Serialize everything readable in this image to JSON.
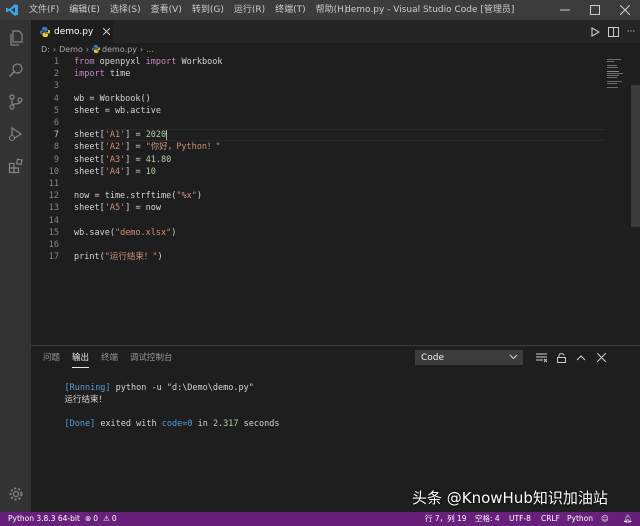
{
  "titlebar": {
    "menu": [
      "文件(F)",
      "编辑(E)",
      "选择(S)",
      "查看(V)",
      "转到(G)",
      "运行(R)",
      "终端(T)",
      "帮助(H)"
    ],
    "title": "demo.py - Visual Studio Code [管理员]"
  },
  "tab": {
    "label": "demo.py"
  },
  "breadcrumb": {
    "drive": "D:",
    "folder": "Demo",
    "file": "demo.py",
    "more": "..."
  },
  "editor": {
    "lines": [
      {
        "n": "1",
        "parts": [
          [
            "kw",
            "from"
          ],
          [
            "plain",
            " openpyxl "
          ],
          [
            "kw",
            "import"
          ],
          [
            "plain",
            " Workbook"
          ]
        ]
      },
      {
        "n": "2",
        "parts": [
          [
            "kw",
            "import"
          ],
          [
            "plain",
            " time"
          ]
        ]
      },
      {
        "n": "3",
        "parts": []
      },
      {
        "n": "4",
        "parts": [
          [
            "plain",
            "wb = Workbook()"
          ]
        ]
      },
      {
        "n": "5",
        "parts": [
          [
            "plain",
            "sheet = wb.active"
          ]
        ]
      },
      {
        "n": "6",
        "parts": []
      },
      {
        "n": "7",
        "parts": [
          [
            "plain",
            "sheet["
          ],
          [
            "str",
            "'A1'"
          ],
          [
            "plain",
            "] = "
          ],
          [
            "num",
            "2020"
          ]
        ]
      },
      {
        "n": "8",
        "parts": [
          [
            "plain",
            "sheet["
          ],
          [
            "str",
            "'A2'"
          ],
          [
            "plain",
            "] = "
          ],
          [
            "str",
            "\"你好，Python！\""
          ]
        ]
      },
      {
        "n": "9",
        "parts": [
          [
            "plain",
            "sheet["
          ],
          [
            "str",
            "'A3'"
          ],
          [
            "plain",
            "] = "
          ],
          [
            "num",
            "41.80"
          ]
        ]
      },
      {
        "n": "10",
        "parts": [
          [
            "plain",
            "sheet["
          ],
          [
            "str",
            "'A4'"
          ],
          [
            "plain",
            "] = "
          ],
          [
            "num",
            "10"
          ]
        ]
      },
      {
        "n": "11",
        "parts": []
      },
      {
        "n": "12",
        "parts": [
          [
            "plain",
            "now = time.strftime("
          ],
          [
            "str",
            "\"%x\""
          ],
          [
            "plain",
            ")"
          ]
        ]
      },
      {
        "n": "13",
        "parts": [
          [
            "plain",
            "sheet["
          ],
          [
            "str",
            "'A5'"
          ],
          [
            "plain",
            "] = now"
          ]
        ]
      },
      {
        "n": "14",
        "parts": []
      },
      {
        "n": "15",
        "parts": [
          [
            "plain",
            "wb.save("
          ],
          [
            "str",
            "\"demo.xlsx\""
          ],
          [
            "plain",
            ")"
          ]
        ]
      },
      {
        "n": "16",
        "parts": []
      },
      {
        "n": "17",
        "parts": [
          [
            "plain",
            "print("
          ],
          [
            "str",
            "\"运行结束！\""
          ],
          [
            "plain",
            ")"
          ]
        ]
      }
    ],
    "current_line": 7
  },
  "panel": {
    "tabs": [
      "问题",
      "输出",
      "终端",
      "调试控制台"
    ],
    "active_tab": "输出",
    "select_value": "Code",
    "output": {
      "running_tag": "[Running]",
      "running_cmd": " python -u \"d:\\Demo\\demo.py\"",
      "result": "运行结束！",
      "done_tag": "[Done]",
      "done_text": " exited with ",
      "code_label": "code=0",
      "done_in": " in ",
      "elapsed": "2.317",
      "seconds": " seconds"
    }
  },
  "statusbar": {
    "interpreter": "Python 3.8.3 64-bit",
    "errors": "0",
    "warnings": "0",
    "position": "行 7，列 19",
    "spaces": "空格: 4",
    "encoding": "UTF-8",
    "eol": "CRLF",
    "language": "Python"
  },
  "watermark": {
    "text": "头条 @KnowHub知识加油站"
  },
  "colors": {
    "statusbar": "#68217a",
    "keyword": "#c586c0",
    "string": "#ce9178",
    "number": "#b5cea8",
    "output_blue": "#569cd6"
  }
}
